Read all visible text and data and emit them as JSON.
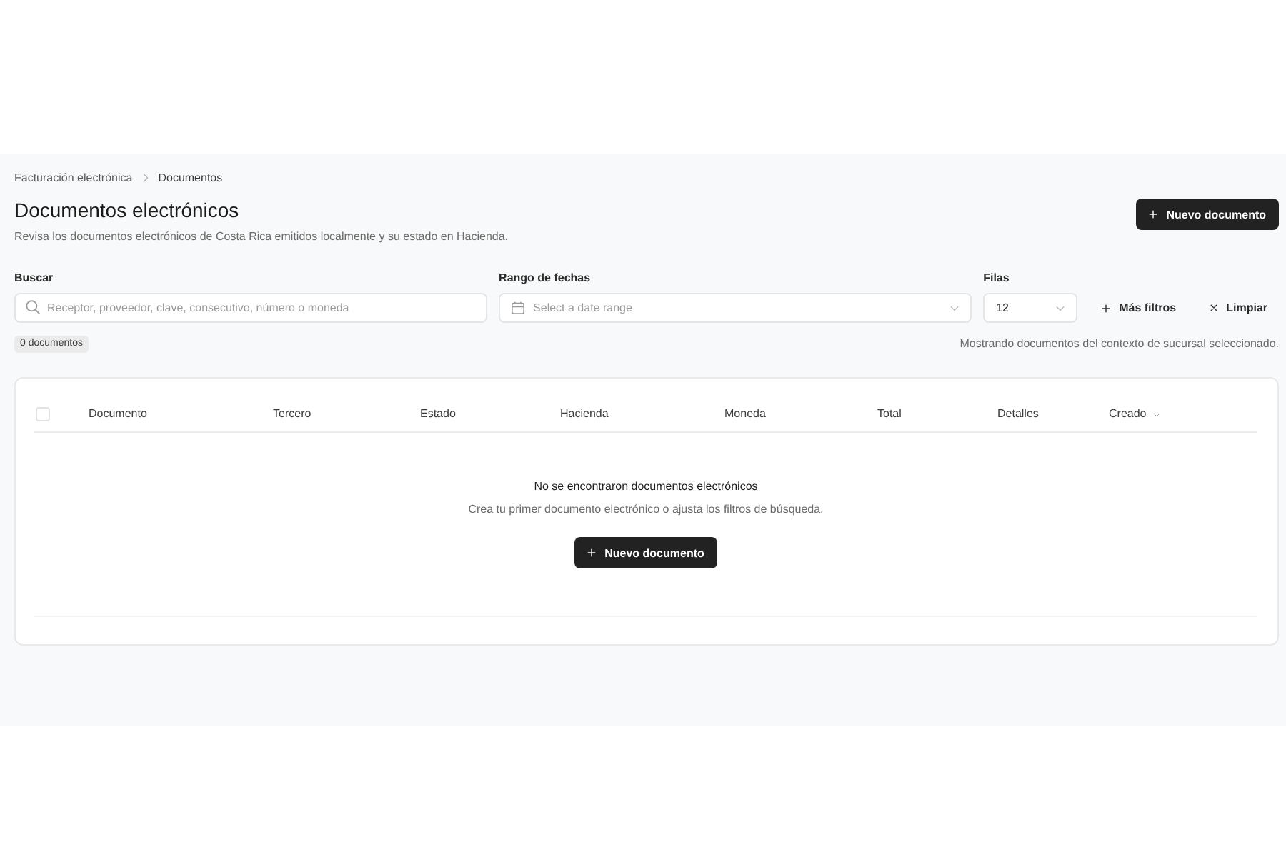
{
  "breadcrumb": [
    {
      "label": "Facturación electrónica"
    },
    {
      "label": "Documentos"
    }
  ],
  "header": {
    "title": "Documentos electrónicos",
    "subtitle": "Revisa los documentos electrónicos de Costa Rica emitidos localmente y su estado en Hacienda.",
    "new_button": {
      "label": "Nuevo documento"
    }
  },
  "filters": {
    "search": {
      "label": "Buscar",
      "placeholder": "Receptor, proveedor, clave, consecutivo, número o moneda"
    },
    "date_range": {
      "label": "Rango de fechas",
      "placeholder": "Select a date range"
    },
    "rows": {
      "label": "Filas",
      "value": "12"
    },
    "more_filters": {
      "label": "Más filtros"
    },
    "clear": {
      "label": "Limpiar"
    }
  },
  "summary": {
    "count_badge": "0 documentos",
    "context_note": "Mostrando documentos del contexto de sucursal seleccionado."
  },
  "table": {
    "select_all": {
      "checked": false
    },
    "columns": [
      {
        "label": "Documento",
        "sorted": false
      },
      {
        "label": "Tercero",
        "sorted": false
      },
      {
        "label": "Estado",
        "sorted": false
      },
      {
        "label": "Hacienda",
        "sorted": false
      },
      {
        "label": "Moneda",
        "sorted": false
      },
      {
        "label": "Total",
        "sorted": false
      },
      {
        "label": "Detalles",
        "sorted": false
      },
      {
        "label": "Creado",
        "sorted": true
      }
    ],
    "empty_state": {
      "title": "No se encontraron documentos electrónicos",
      "message": "Crea tu primer documento electrónico o ajusta los filtros de búsqueda.",
      "button": {
        "label": "Nuevo documento"
      }
    }
  }
}
